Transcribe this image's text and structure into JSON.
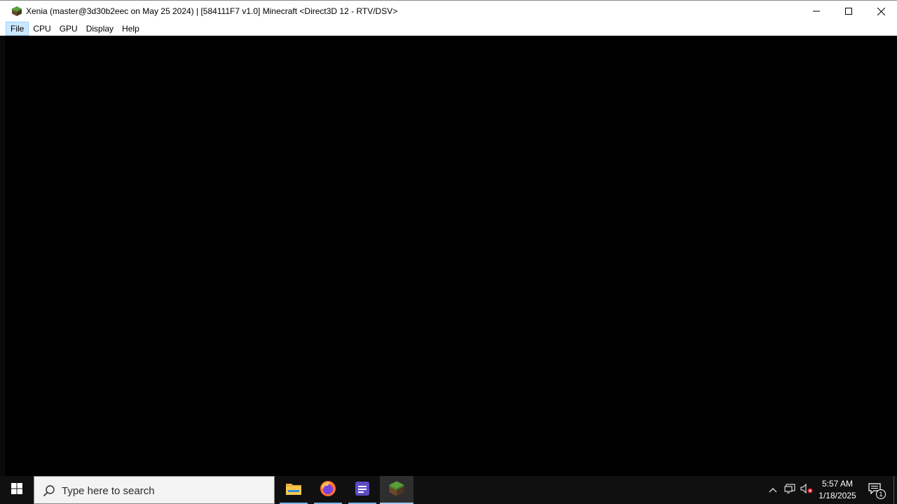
{
  "window": {
    "title": "Xenia (master@3d30b2eec on May 25 2024) | [584111F7 v1.0] Minecraft <Direct3D 12 - RTV/DSV>",
    "app_icon": "minecraft-grass-block-icon",
    "controls": {
      "minimize_icon": "minimize-icon",
      "maximize_icon": "maximize-icon",
      "close_icon": "close-icon"
    }
  },
  "menubar": {
    "items": [
      {
        "label": "File",
        "active": true
      },
      {
        "label": "CPU"
      },
      {
        "label": "GPU"
      },
      {
        "label": "Display"
      },
      {
        "label": "Help"
      }
    ]
  },
  "taskbar": {
    "search": {
      "placeholder": "Type here to search"
    },
    "apps": [
      {
        "name": "file-explorer",
        "icon": "folder-icon"
      },
      {
        "name": "firefox",
        "icon": "firefox-icon"
      },
      {
        "name": "notes-app",
        "icon": "purple-app-icon"
      },
      {
        "name": "xenia-minecraft",
        "icon": "minecraft-grass-block-icon",
        "active": true
      }
    ],
    "tray": {
      "time": "5:57 AM",
      "date": "1/18/2025",
      "notification_count": "1"
    }
  },
  "colors": {
    "taskbar_bg": "#101010",
    "render_bg": "#000000",
    "menu_active": "#cce8ff",
    "accent_underline": "#7ab4e8"
  }
}
